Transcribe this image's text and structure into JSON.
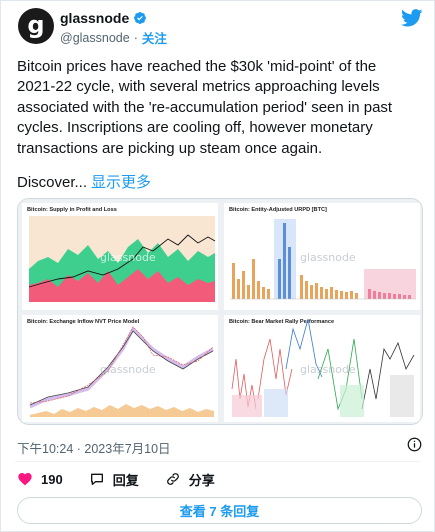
{
  "tweet": {
    "display_name": "glassnode",
    "avatar_letter": "g",
    "handle": "@glassnode",
    "separator": "·",
    "follow_label": "关注",
    "body": "Bitcoin prices have reached the $30k 'mid-point' of the\n2021-22 cycle, with several metrics approaching levels\nassociated with the 're-accumulation period' seen in past\ncycles. Inscriptions are cooling off, however monetary\ntransactions are picking up steam once again.",
    "discover_prefix": "Discover...",
    "discover_more": "显示更多",
    "timestamp": "下午10:24 · 2023年7月10日",
    "like_count": "190",
    "reply_label": "回复",
    "share_label": "分享",
    "view_replies_label": "查看 7 条回复"
  },
  "media": {
    "watermark": "glassnode",
    "panels": [
      {
        "title": "Bitcoin: Supply in Profit and Loss"
      },
      {
        "title": "Bitcoin: Entity-Adjusted URPD [BTC]"
      },
      {
        "title": "Bitcoin: Exchange Inflow NVT Price Model"
      },
      {
        "title": "Bitcoin: Bear Market Rally Performance"
      }
    ]
  },
  "colors": {
    "accent": "#1d9bf0",
    "like": "#f91880",
    "text": "#0f1419",
    "secondary": "#536471"
  },
  "icons": [
    "verified-badge-icon",
    "twitter-bird-icon",
    "info-icon",
    "heart-icon",
    "reply-icon",
    "share-icon"
  ]
}
